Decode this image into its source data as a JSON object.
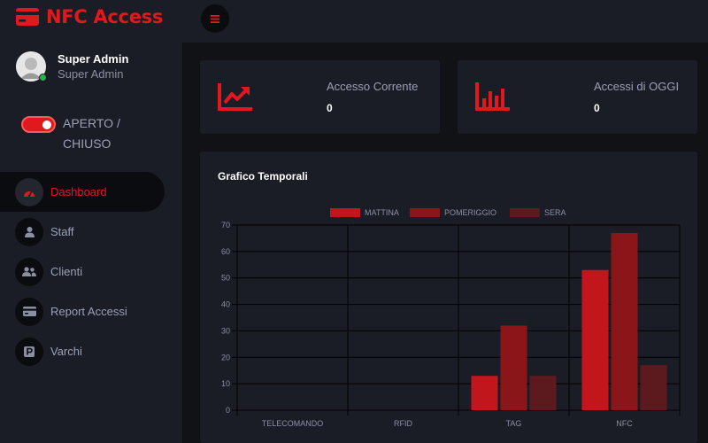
{
  "brand": {
    "title": "NFC Access"
  },
  "user": {
    "name": "Super Admin",
    "role": "Super Admin"
  },
  "toggle": {
    "label": "APERTO / CHIUSO",
    "on": true
  },
  "nav": {
    "items": [
      {
        "label": "Dashboard",
        "icon": "speedometer-icon",
        "active": true
      },
      {
        "label": "Staff",
        "icon": "user-icon",
        "active": false
      },
      {
        "label": "Clienti",
        "icon": "users-icon",
        "active": false
      },
      {
        "label": "Report Accessi",
        "icon": "credit-card-icon",
        "active": false
      },
      {
        "label": "Varchi",
        "icon": "parking-icon",
        "active": false
      }
    ]
  },
  "stats": [
    {
      "title": "Accesso Corrente",
      "value": "0",
      "icon": "trend-up-chart-icon"
    },
    {
      "title": "Accessi di OGGI",
      "value": "0",
      "icon": "bar-chart-icon"
    }
  ],
  "colors": {
    "accent": "#e0191d",
    "sidebar": "#1b1d26",
    "background": "#111216"
  },
  "chart_data": {
    "type": "bar",
    "title": "Grafico Temporali",
    "categories": [
      "TELECOMANDO",
      "RFID",
      "TAG",
      "NFC"
    ],
    "series": [
      {
        "name": "MATTINA",
        "color": "#c0161c",
        "values": [
          0,
          0,
          13,
          53
        ]
      },
      {
        "name": "POMERIGGIO",
        "color": "#8b1619",
        "values": [
          0,
          0,
          32,
          67
        ]
      },
      {
        "name": "SERA",
        "color": "#5c1a1e",
        "values": [
          0,
          0,
          13,
          17
        ]
      }
    ],
    "ylim": [
      0,
      70
    ],
    "yticks": [
      0,
      10,
      20,
      30,
      40,
      50,
      60,
      70
    ],
    "legend": "top",
    "grid": true
  }
}
